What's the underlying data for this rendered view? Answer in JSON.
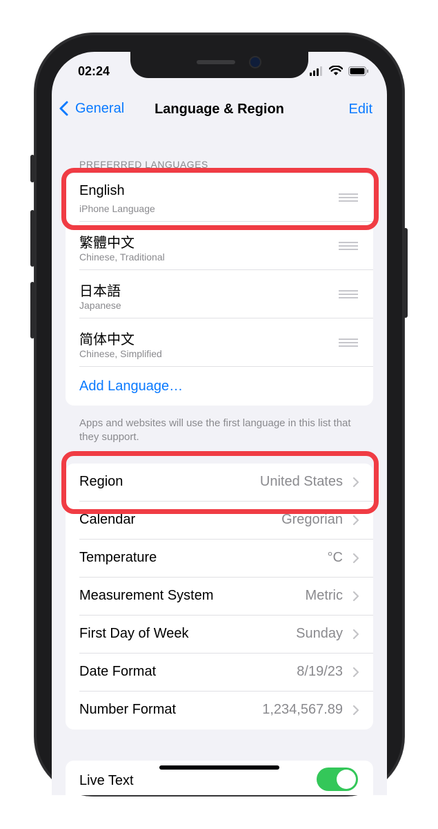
{
  "status": {
    "time": "02:24"
  },
  "nav": {
    "back_label": "General",
    "title": "Language & Region",
    "edit_label": "Edit"
  },
  "preferred_languages": {
    "header": "PREFERRED LANGUAGES",
    "items": [
      {
        "name": "English",
        "subtitle": "iPhone Language"
      },
      {
        "name": "繁體中文",
        "subtitle": "Chinese, Traditional"
      },
      {
        "name": "日本語",
        "subtitle": "Japanese"
      },
      {
        "name": "简体中文",
        "subtitle": "Chinese, Simplified"
      }
    ],
    "add_label": "Add Language…",
    "footer": "Apps and websites will use the first language in this list that they support."
  },
  "region_settings": [
    {
      "label": "Region",
      "value": "United States"
    },
    {
      "label": "Calendar",
      "value": "Gregorian"
    },
    {
      "label": "Temperature",
      "value": "°C"
    },
    {
      "label": "Measurement System",
      "value": "Metric"
    },
    {
      "label": "First Day of Week",
      "value": "Sunday"
    },
    {
      "label": "Date Format",
      "value": "8/19/23"
    },
    {
      "label": "Number Format",
      "value": "1,234,567.89"
    }
  ],
  "bottom": {
    "partial_label": "Live Text",
    "toggle_on": true
  },
  "colors": {
    "accent": "#0a7aff",
    "highlight": "#f03c44",
    "toggle": "#34c759"
  }
}
